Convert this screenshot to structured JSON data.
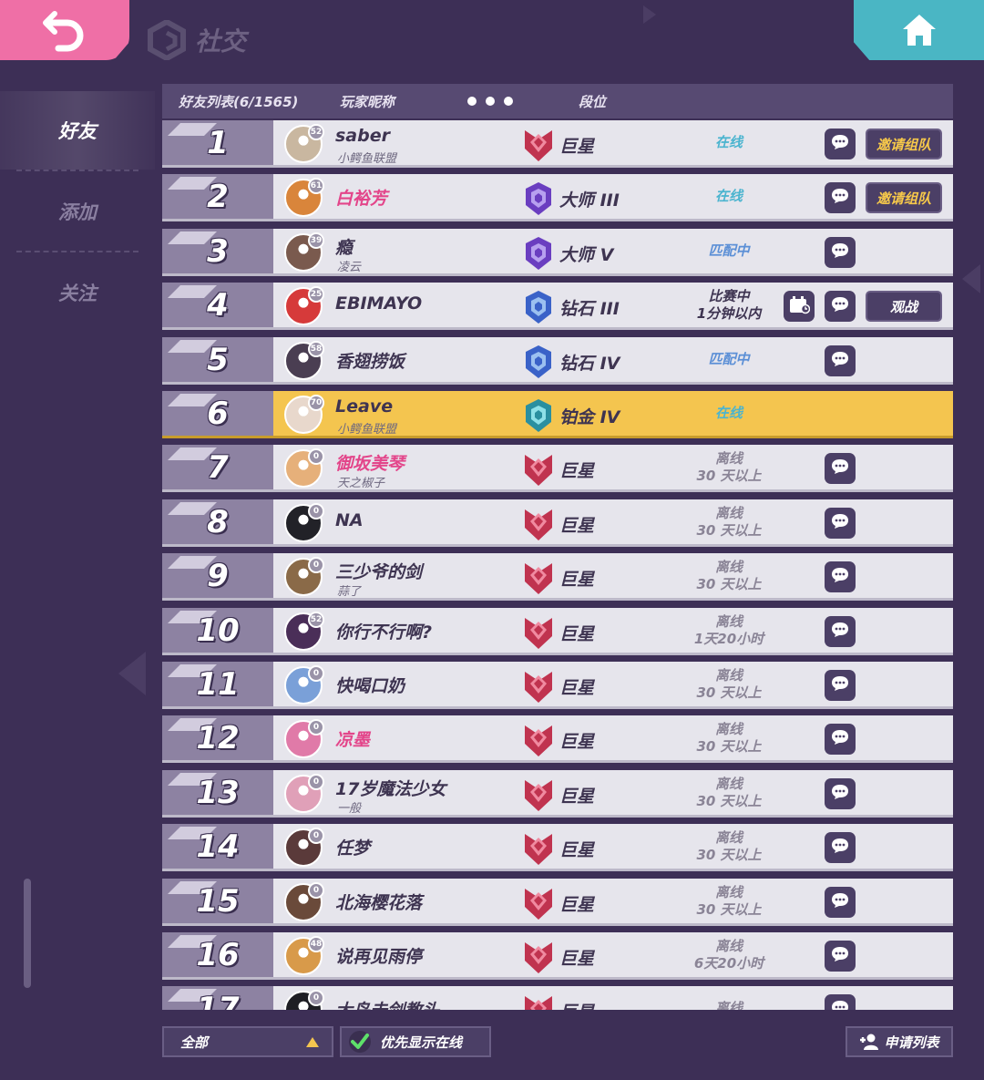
{
  "page": {
    "title": "社交"
  },
  "colors": {
    "accent_pink": "#ef6fa6",
    "accent_teal": "#4ab6c4",
    "highlight_gold": "#f4c54f",
    "online": "#4bb4cf",
    "matching": "#5b8fd6"
  },
  "nav": {
    "items": [
      {
        "label": "好友",
        "active": true
      },
      {
        "label": "添加",
        "active": false
      },
      {
        "label": "关注",
        "active": false
      }
    ]
  },
  "header": {
    "list_label": "好友列表(6/1565)",
    "nickname_label": "玩家昵称",
    "rank_label": "段位"
  },
  "friends": [
    {
      "num": "1",
      "name": "saber",
      "sub": "小鳄鱼联盟",
      "level": "52",
      "rank": "巨星",
      "rank_tier": "star",
      "status": [
        "在线"
      ],
      "status_type": "online",
      "action": "邀请组队",
      "avatar_color": "#c9b7a0"
    },
    {
      "num": "2",
      "name": "白裕芳",
      "sub": "",
      "level": "61",
      "rank": "大师 III",
      "rank_tier": "master",
      "status": [
        "在线"
      ],
      "status_type": "online",
      "action": "邀请组队",
      "pink": true,
      "avatar_color": "#d9853b"
    },
    {
      "num": "3",
      "name": "瘾",
      "sub": "凌云",
      "level": "39",
      "rank": "大师 V",
      "rank_tier": "master",
      "status": [
        "匹配中"
      ],
      "status_type": "matching",
      "action": "",
      "avatar_color": "#7a5a4e"
    },
    {
      "num": "4",
      "name": "EBIMAYO",
      "sub": "",
      "level": "25",
      "rank": "钻石 III",
      "rank_tier": "diamond",
      "status": [
        "比赛中",
        "1分钟以内"
      ],
      "status_type": "ingame",
      "action": "观战",
      "spectate_icon": true,
      "avatar_color": "#d63a3a"
    },
    {
      "num": "5",
      "name": "香翅捞饭",
      "sub": "",
      "level": "58",
      "rank": "钻石 IV",
      "rank_tier": "diamond",
      "status": [
        "匹配中"
      ],
      "status_type": "matching",
      "action": "",
      "avatar_color": "#4a3e52"
    },
    {
      "num": "6",
      "name": "Leave",
      "sub": "小鳄鱼联盟",
      "level": "70",
      "rank": "铂金 IV",
      "rank_tier": "platinum",
      "status": [
        "在线"
      ],
      "status_type": "online",
      "action": "",
      "self": true,
      "avatar_color": "#e8d8cc"
    },
    {
      "num": "7",
      "name": "御坂美琴",
      "sub": "天之椒子",
      "level": "0",
      "rank": "巨星",
      "rank_tier": "star",
      "status": [
        "离线",
        "30 天以上"
      ],
      "status_type": "offline",
      "action": "",
      "pink": true,
      "avatar_color": "#e6b07a"
    },
    {
      "num": "8",
      "name": "NA",
      "sub": "",
      "level": "0",
      "rank": "巨星",
      "rank_tier": "star",
      "status": [
        "离线",
        "30 天以上"
      ],
      "status_type": "offline",
      "action": "",
      "avatar_color": "#222228"
    },
    {
      "num": "9",
      "name": "三少爷的剑",
      "sub": "蒜了",
      "level": "0",
      "rank": "巨星",
      "rank_tier": "star",
      "status": [
        "离线",
        "30 天以上"
      ],
      "status_type": "offline",
      "action": "",
      "avatar_color": "#8a6a48"
    },
    {
      "num": "10",
      "name": "你行不行啊?",
      "sub": "",
      "level": "52",
      "rank": "巨星",
      "rank_tier": "star",
      "status": [
        "离线",
        "1天20小时"
      ],
      "status_type": "offline",
      "action": "",
      "avatar_color": "#4a2e58"
    },
    {
      "num": "11",
      "name": "快喝口奶",
      "sub": "",
      "level": "0",
      "rank": "巨星",
      "rank_tier": "star",
      "status": [
        "离线",
        "30 天以上"
      ],
      "status_type": "offline",
      "action": "",
      "avatar_color": "#7aa0d8"
    },
    {
      "num": "12",
      "name": "凉墨",
      "sub": "",
      "level": "0",
      "rank": "巨星",
      "rank_tier": "star",
      "status": [
        "离线",
        "30 天以上"
      ],
      "status_type": "offline",
      "action": "",
      "pink": true,
      "avatar_color": "#e07aa8"
    },
    {
      "num": "13",
      "name": "17岁魔法少女",
      "sub": "一般",
      "level": "0",
      "rank": "巨星",
      "rank_tier": "star",
      "status": [
        "离线",
        "30 天以上"
      ],
      "status_type": "offline",
      "action": "",
      "avatar_color": "#e0a0b8"
    },
    {
      "num": "14",
      "name": "任梦",
      "sub": "",
      "level": "0",
      "rank": "巨星",
      "rank_tier": "star",
      "status": [
        "离线",
        "30 天以上"
      ],
      "status_type": "offline",
      "action": "",
      "avatar_color": "#5a3a3a"
    },
    {
      "num": "15",
      "name": "北海樱花落",
      "sub": "",
      "level": "0",
      "rank": "巨星",
      "rank_tier": "star",
      "status": [
        "离线",
        "30 天以上"
      ],
      "status_type": "offline",
      "action": "",
      "avatar_color": "#6a4a3a"
    },
    {
      "num": "16",
      "name": "说再见雨停",
      "sub": "",
      "level": "48",
      "rank": "巨星",
      "rank_tier": "star",
      "status": [
        "离线",
        "6天20小时"
      ],
      "status_type": "offline",
      "action": "",
      "avatar_color": "#d89a4a"
    },
    {
      "num": "17",
      "name": "大鸟击剑教头",
      "sub": "",
      "level": "0",
      "rank": "巨星",
      "rank_tier": "star",
      "status": [
        "离线"
      ],
      "status_type": "offline",
      "action": "",
      "avatar_color": "#1e1e24"
    }
  ],
  "footer": {
    "filter_label": "全部",
    "online_first_label": "优先显示在线",
    "online_first_checked": true,
    "apply_list_label": "申请列表"
  }
}
